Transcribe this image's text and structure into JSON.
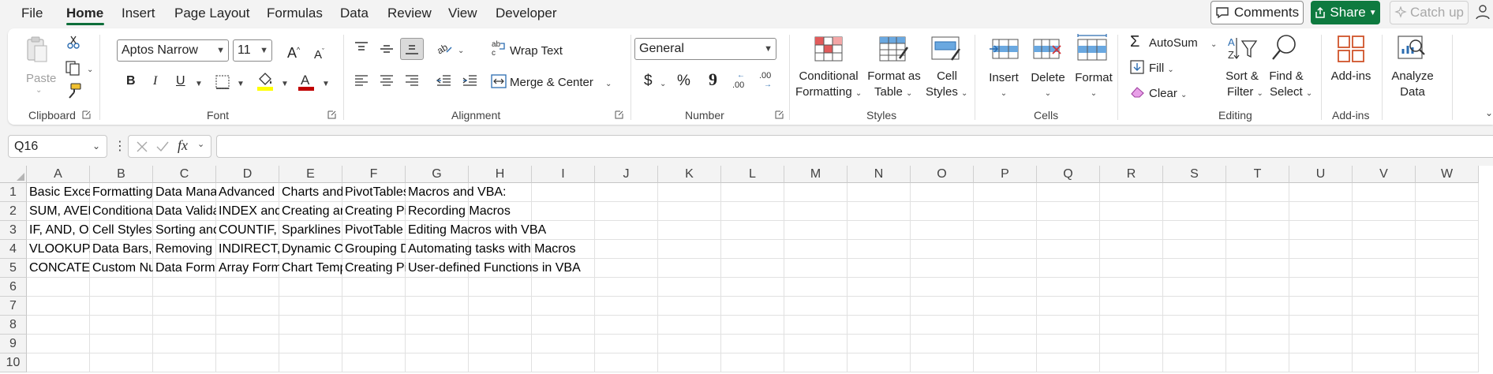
{
  "menu": {
    "tabs": [
      "File",
      "Home",
      "Insert",
      "Page Layout",
      "Formulas",
      "Data",
      "Review",
      "View",
      "Developer"
    ],
    "comments_label": "Comments",
    "share_label": "Share",
    "catchup_label": "Catch up"
  },
  "ribbon": {
    "clipboard": {
      "paste": "Paste",
      "group": "Clipboard"
    },
    "font": {
      "name": "Aptos Narrow",
      "size": "11",
      "bold": "B",
      "italic": "I",
      "underline": "U",
      "group": "Font",
      "font_color": "#c00000",
      "fill_color": "#ffff00"
    },
    "alignment": {
      "wrap": "Wrap Text",
      "merge": "Merge & Center",
      "group": "Alignment"
    },
    "number": {
      "format": "General",
      "currency": "$",
      "percent": "%",
      "comma": "9",
      "inc": ".00",
      "dec": ".00",
      "group": "Number"
    },
    "styles": {
      "conditional_1": "Conditional",
      "conditional_2": "Formatting",
      "format_table_1": "Format as",
      "format_table_2": "Table",
      "cell_styles_1": "Cell",
      "cell_styles_2": "Styles",
      "group": "Styles"
    },
    "cells": {
      "insert": "Insert",
      "delete": "Delete",
      "format": "Format",
      "group": "Cells"
    },
    "editing": {
      "autosum": "AutoSum",
      "fill": "Fill",
      "clear": "Clear",
      "sort_1": "Sort &",
      "sort_2": "Filter",
      "find_1": "Find &",
      "find_2": "Select",
      "group": "Editing"
    },
    "addins": {
      "label": "Add-ins",
      "group": "Add-ins"
    },
    "analyze": {
      "label_1": "Analyze",
      "label_2": "Data"
    }
  },
  "formula_bar": {
    "name_box": "Q16",
    "fx": "fx",
    "formula": ""
  },
  "grid": {
    "columns": [
      "A",
      "B",
      "C",
      "D",
      "E",
      "F",
      "G",
      "H",
      "I",
      "J",
      "K",
      "L",
      "M",
      "N",
      "O",
      "P",
      "Q",
      "R",
      "S",
      "T",
      "U",
      "V",
      "W"
    ],
    "rows": [
      "1",
      "2",
      "3",
      "4",
      "5",
      "6",
      "7",
      "8",
      "9",
      "10"
    ],
    "cells": [
      [
        "Basic Exce",
        "Formatting",
        "Data Mana",
        "Advanced ",
        "Charts and",
        "PivotTables",
        "Macros and VBA:"
      ],
      [
        "SUM, AVER",
        "Conditiona",
        "Data Valida",
        "INDEX and",
        "Creating ar",
        "Creating Pi",
        "Recording Macros"
      ],
      [
        "IF, AND, OI",
        "Cell Styles",
        "Sorting and",
        "COUNTIF,",
        "Sparklines",
        "PivotTable",
        "Editing Macros with VBA"
      ],
      [
        "VLOOKUP,",
        "Data Bars,",
        "Removing I",
        "INDIRECT,",
        "Dynamic C",
        "Grouping D",
        "Automating tasks with Macros"
      ],
      [
        "CONCATEI",
        "Custom Nu",
        "Data Form",
        "Array Form",
        "Chart Temp",
        "Creating Pi",
        "User-defined Functions in VBA"
      ]
    ]
  },
  "colors": {
    "accent_green": "#0e7a3f",
    "tab_underline": "#0e6e3a"
  }
}
